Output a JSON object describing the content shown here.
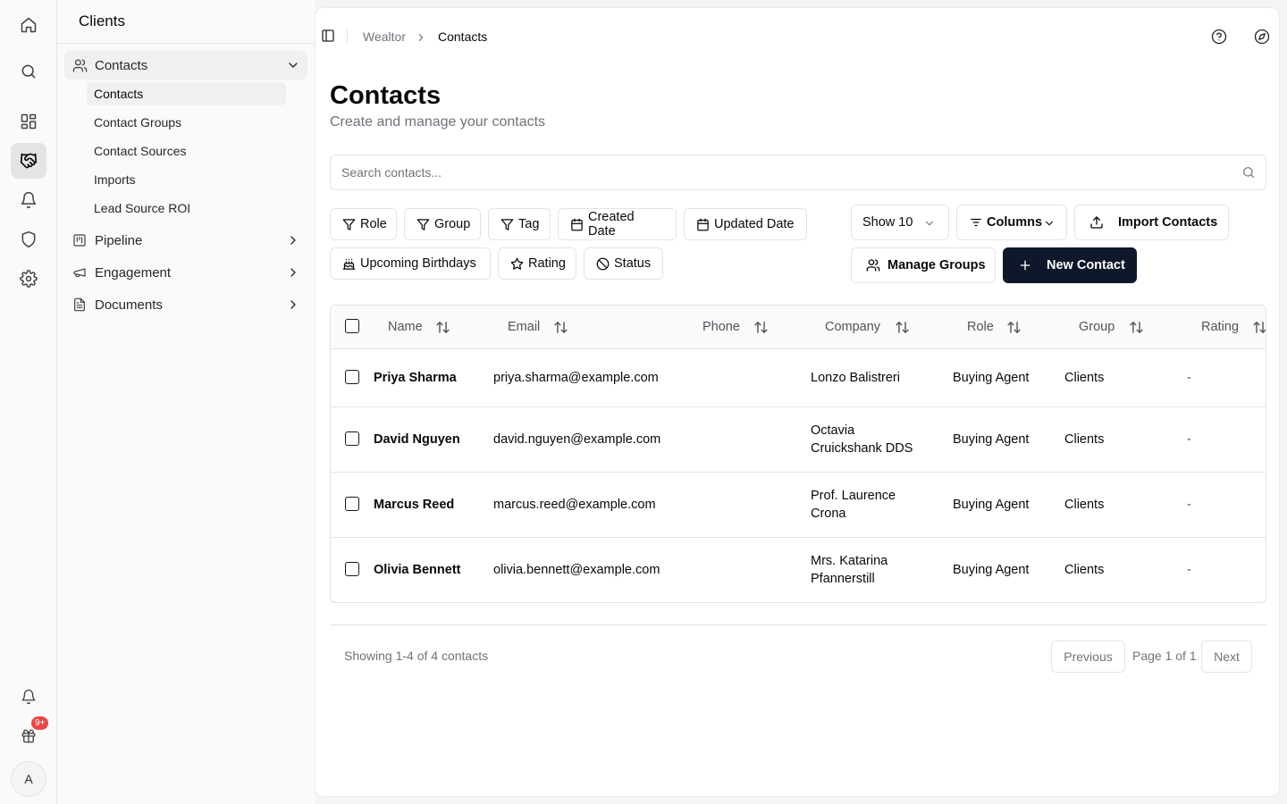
{
  "rail": {
    "badge": "9+",
    "avatar_initial": "A",
    "icons": [
      "home-icon",
      "search-icon",
      "dashboard-icon",
      "handshake-icon",
      "bell-icon",
      "shield-icon",
      "gear-icon",
      "notification-icon",
      "gift-icon"
    ]
  },
  "sidebar": {
    "title": "Clients",
    "groups": [
      {
        "label": "Contacts",
        "icon": "users-icon",
        "expanded": true
      },
      {
        "label": "Pipeline",
        "icon": "kanban-icon",
        "expanded": false
      },
      {
        "label": "Engagement",
        "icon": "megaphone-icon",
        "expanded": false
      },
      {
        "label": "Documents",
        "icon": "document-icon",
        "expanded": false
      }
    ],
    "contacts_items": [
      "Contacts",
      "Contact Groups",
      "Contact Sources",
      "Imports",
      "Lead Source ROI"
    ]
  },
  "breadcrumb": {
    "root": "Wealtor",
    "current": "Contacts"
  },
  "page": {
    "title": "Contacts",
    "subtitle": "Create and manage your contacts"
  },
  "search": {
    "placeholder": "Search contacts..."
  },
  "filters": [
    {
      "label": "Role",
      "icon": "filter-icon"
    },
    {
      "label": "Group",
      "icon": "filter-icon"
    },
    {
      "label": "Tag",
      "icon": "filter-icon"
    },
    {
      "label": "Created Date",
      "icon": "calendar-icon"
    },
    {
      "label": "Updated Date",
      "icon": "calendar-icon"
    },
    {
      "label": "Upcoming Birthdays",
      "icon": "cake-icon"
    },
    {
      "label": "Rating",
      "icon": "star-icon"
    },
    {
      "label": "Status",
      "icon": "ban-icon"
    }
  ],
  "toolbar": {
    "show_label": "Show 10",
    "columns_label": "Columns",
    "import_label": "Import Contacts",
    "manage_groups_label": "Manage Groups",
    "new_contact_label": "New Contact"
  },
  "table": {
    "headers": [
      "Name",
      "Email",
      "Phone",
      "Company",
      "Role",
      "Group",
      "Rating"
    ],
    "rows": [
      {
        "name": "Priya Sharma",
        "email": "priya.sharma@example.com",
        "phone": "",
        "company": [
          "Lonzo Balistreri"
        ],
        "role": "Buying Agent",
        "group": "Clients",
        "rating": "-"
      },
      {
        "name": "David Nguyen",
        "email": "david.nguyen@example.com",
        "phone": "",
        "company": [
          "Octavia",
          "Cruickshank DDS"
        ],
        "role": "Buying Agent",
        "group": "Clients",
        "rating": "-"
      },
      {
        "name": "Marcus Reed",
        "email": "marcus.reed@example.com",
        "phone": "",
        "company": [
          "Prof. Laurence",
          "Crona"
        ],
        "role": "Buying Agent",
        "group": "Clients",
        "rating": "-"
      },
      {
        "name": "Olivia Bennett",
        "email": "olivia.bennett@example.com",
        "phone": "",
        "company": [
          "Mrs. Katarina",
          "Pfannerstill"
        ],
        "role": "Buying Agent",
        "group": "Clients",
        "rating": "-"
      }
    ]
  },
  "pagination": {
    "summary": "Showing 1-4 of 4 contacts",
    "previous": "Previous",
    "page_label": "Page 1 of 1",
    "next": "Next"
  },
  "colors": {
    "primary_button": "#0f172a",
    "badge": "#ef4444",
    "border": "#e4e4e7"
  }
}
